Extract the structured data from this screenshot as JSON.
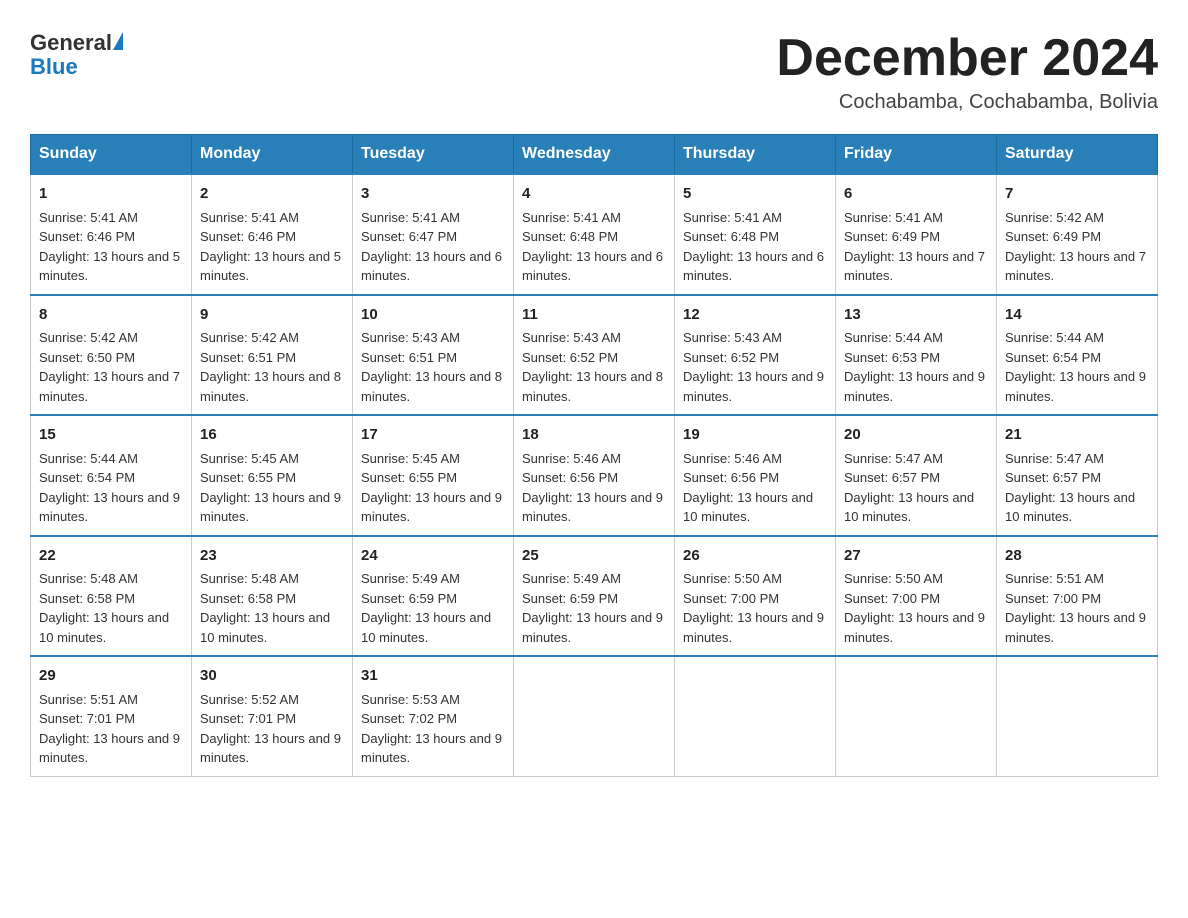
{
  "header": {
    "logo_general": "General",
    "logo_blue": "Blue",
    "month_title": "December 2024",
    "location": "Cochabamba, Cochabamba, Bolivia"
  },
  "calendar": {
    "days_of_week": [
      "Sunday",
      "Monday",
      "Tuesday",
      "Wednesday",
      "Thursday",
      "Friday",
      "Saturday"
    ],
    "weeks": [
      [
        {
          "day": "1",
          "sunrise": "5:41 AM",
          "sunset": "6:46 PM",
          "daylight": "13 hours and 5 minutes."
        },
        {
          "day": "2",
          "sunrise": "5:41 AM",
          "sunset": "6:46 PM",
          "daylight": "13 hours and 5 minutes."
        },
        {
          "day": "3",
          "sunrise": "5:41 AM",
          "sunset": "6:47 PM",
          "daylight": "13 hours and 6 minutes."
        },
        {
          "day": "4",
          "sunrise": "5:41 AM",
          "sunset": "6:48 PM",
          "daylight": "13 hours and 6 minutes."
        },
        {
          "day": "5",
          "sunrise": "5:41 AM",
          "sunset": "6:48 PM",
          "daylight": "13 hours and 6 minutes."
        },
        {
          "day": "6",
          "sunrise": "5:41 AM",
          "sunset": "6:49 PM",
          "daylight": "13 hours and 7 minutes."
        },
        {
          "day": "7",
          "sunrise": "5:42 AM",
          "sunset": "6:49 PM",
          "daylight": "13 hours and 7 minutes."
        }
      ],
      [
        {
          "day": "8",
          "sunrise": "5:42 AM",
          "sunset": "6:50 PM",
          "daylight": "13 hours and 7 minutes."
        },
        {
          "day": "9",
          "sunrise": "5:42 AM",
          "sunset": "6:51 PM",
          "daylight": "13 hours and 8 minutes."
        },
        {
          "day": "10",
          "sunrise": "5:43 AM",
          "sunset": "6:51 PM",
          "daylight": "13 hours and 8 minutes."
        },
        {
          "day": "11",
          "sunrise": "5:43 AM",
          "sunset": "6:52 PM",
          "daylight": "13 hours and 8 minutes."
        },
        {
          "day": "12",
          "sunrise": "5:43 AM",
          "sunset": "6:52 PM",
          "daylight": "13 hours and 9 minutes."
        },
        {
          "day": "13",
          "sunrise": "5:44 AM",
          "sunset": "6:53 PM",
          "daylight": "13 hours and 9 minutes."
        },
        {
          "day": "14",
          "sunrise": "5:44 AM",
          "sunset": "6:54 PM",
          "daylight": "13 hours and 9 minutes."
        }
      ],
      [
        {
          "day": "15",
          "sunrise": "5:44 AM",
          "sunset": "6:54 PM",
          "daylight": "13 hours and 9 minutes."
        },
        {
          "day": "16",
          "sunrise": "5:45 AM",
          "sunset": "6:55 PM",
          "daylight": "13 hours and 9 minutes."
        },
        {
          "day": "17",
          "sunrise": "5:45 AM",
          "sunset": "6:55 PM",
          "daylight": "13 hours and 9 minutes."
        },
        {
          "day": "18",
          "sunrise": "5:46 AM",
          "sunset": "6:56 PM",
          "daylight": "13 hours and 9 minutes."
        },
        {
          "day": "19",
          "sunrise": "5:46 AM",
          "sunset": "6:56 PM",
          "daylight": "13 hours and 10 minutes."
        },
        {
          "day": "20",
          "sunrise": "5:47 AM",
          "sunset": "6:57 PM",
          "daylight": "13 hours and 10 minutes."
        },
        {
          "day": "21",
          "sunrise": "5:47 AM",
          "sunset": "6:57 PM",
          "daylight": "13 hours and 10 minutes."
        }
      ],
      [
        {
          "day": "22",
          "sunrise": "5:48 AM",
          "sunset": "6:58 PM",
          "daylight": "13 hours and 10 minutes."
        },
        {
          "day": "23",
          "sunrise": "5:48 AM",
          "sunset": "6:58 PM",
          "daylight": "13 hours and 10 minutes."
        },
        {
          "day": "24",
          "sunrise": "5:49 AM",
          "sunset": "6:59 PM",
          "daylight": "13 hours and 10 minutes."
        },
        {
          "day": "25",
          "sunrise": "5:49 AM",
          "sunset": "6:59 PM",
          "daylight": "13 hours and 9 minutes."
        },
        {
          "day": "26",
          "sunrise": "5:50 AM",
          "sunset": "7:00 PM",
          "daylight": "13 hours and 9 minutes."
        },
        {
          "day": "27",
          "sunrise": "5:50 AM",
          "sunset": "7:00 PM",
          "daylight": "13 hours and 9 minutes."
        },
        {
          "day": "28",
          "sunrise": "5:51 AM",
          "sunset": "7:00 PM",
          "daylight": "13 hours and 9 minutes."
        }
      ],
      [
        {
          "day": "29",
          "sunrise": "5:51 AM",
          "sunset": "7:01 PM",
          "daylight": "13 hours and 9 minutes."
        },
        {
          "day": "30",
          "sunrise": "5:52 AM",
          "sunset": "7:01 PM",
          "daylight": "13 hours and 9 minutes."
        },
        {
          "day": "31",
          "sunrise": "5:53 AM",
          "sunset": "7:02 PM",
          "daylight": "13 hours and 9 minutes."
        },
        null,
        null,
        null,
        null
      ]
    ]
  }
}
